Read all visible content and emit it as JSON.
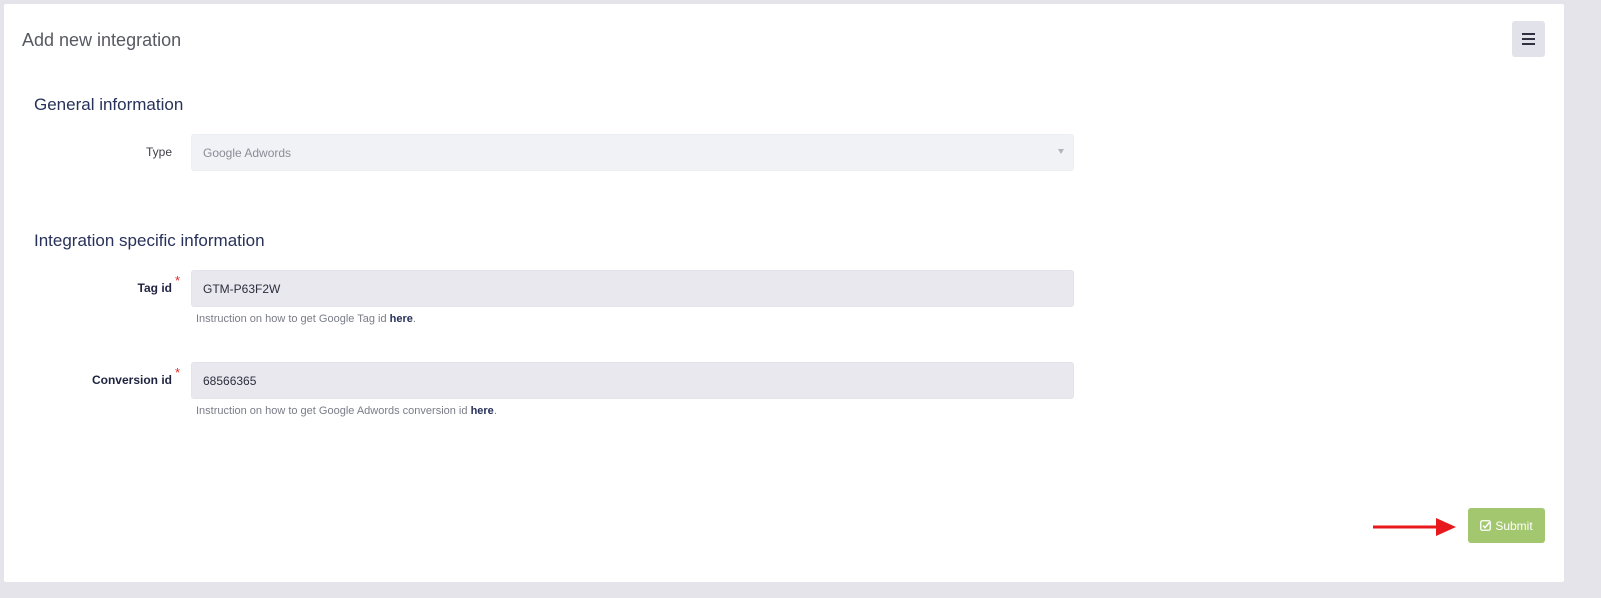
{
  "header": {
    "title": "Add new integration",
    "menu_icon": "hamburger-menu-icon"
  },
  "general": {
    "section_title": "General information",
    "type_label": "Type",
    "type_value": "Google Adwords"
  },
  "specific": {
    "section_title": "Integration specific information",
    "tag": {
      "label": "Tag id",
      "required_mark": "*",
      "value": "GTM-P63F2W",
      "help_text": "Instruction on how to get Google Tag id ",
      "help_link": "here",
      "help_end": "."
    },
    "conversion": {
      "label": "Conversion id",
      "required_mark": "*",
      "value": "68566365",
      "help_text": "Instruction on how to get Google Adwords conversion id ",
      "help_link": "here",
      "help_end": "."
    }
  },
  "actions": {
    "submit_label": "Submit",
    "submit_icon": "check-square-icon",
    "arrow_color": "#e8191c"
  },
  "colors": {
    "accent_submit": "#a3c76f",
    "required": "#e4262b",
    "heading": "#27315a"
  }
}
